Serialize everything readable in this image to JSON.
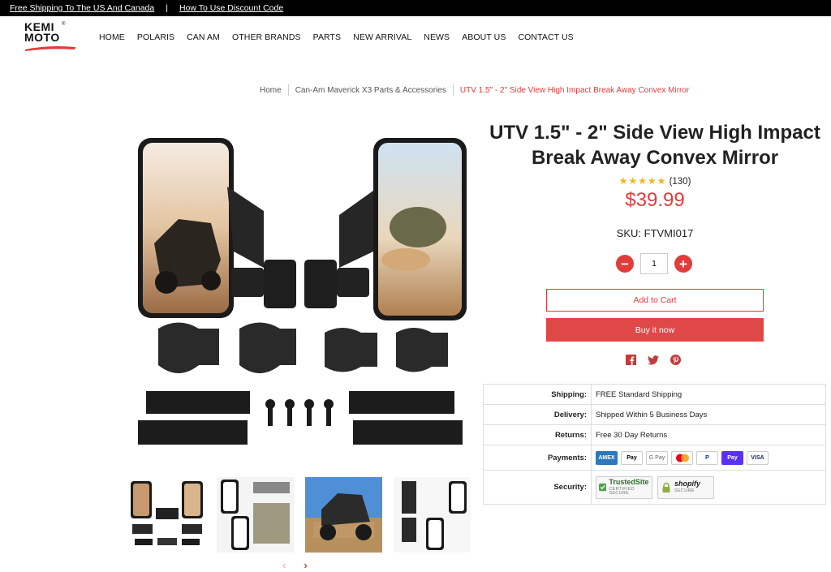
{
  "topbar": {
    "link1": "Free Shipping To The US And Canada",
    "separator": "|",
    "link2": "How To Use Discount Code"
  },
  "logo": {
    "line1": "KEMI",
    "line2": "MOTO",
    "reg": "®"
  },
  "nav": [
    "HOME",
    "POLARIS",
    "CAN AM",
    "OTHER BRANDS",
    "PARTS",
    "NEW ARRIVAL",
    "NEWS",
    "ABOUT US",
    "CONTACT US"
  ],
  "breadcrumb": {
    "home": "Home",
    "category": "Can-Am Maverick X3 Parts & Accessories",
    "current": "UTV 1.5\" - 2\" Side View High Impact Break Away Convex Mirror"
  },
  "product": {
    "title_line1": "UTV 1.5\" - 2\" Side View High Impact",
    "title_line2": "Break Away Convex Mirror",
    "stars": "★★★★★",
    "reviews": "(130)",
    "rating": 5,
    "price": "$39.99",
    "sku": "SKU: FTVMI017",
    "quantity": "1",
    "minus": "−",
    "plus": "+",
    "add_to_cart": "Add to Cart",
    "buy_now": "Buy it now"
  },
  "social": {
    "facebook": "f",
    "twitter": "t",
    "pinterest": "p"
  },
  "info": {
    "shipping_label": "Shipping:",
    "shipping_value": "FREE Standard Shipping",
    "delivery_label": "Delivery:",
    "delivery_value": "Shipped Within 5 Business Days",
    "returns_label": "Returns:",
    "returns_value": "Free 30 Day Returns",
    "payments_label": "Payments:",
    "security_label": "Security:",
    "cards": [
      "AMEX",
      "Pay",
      "G Pay",
      "",
      "P",
      "Pay",
      "VISA"
    ],
    "trusted_title": "TrustedSite",
    "trusted_sub": "CERTIFIED SECURE",
    "shopify_title": "shopify",
    "shopify_sub": "SECURE"
  },
  "carousel": {
    "prev": "‹",
    "next": "›"
  },
  "colors": {
    "accent": "#e23b3b",
    "star": "#f2b51c"
  }
}
